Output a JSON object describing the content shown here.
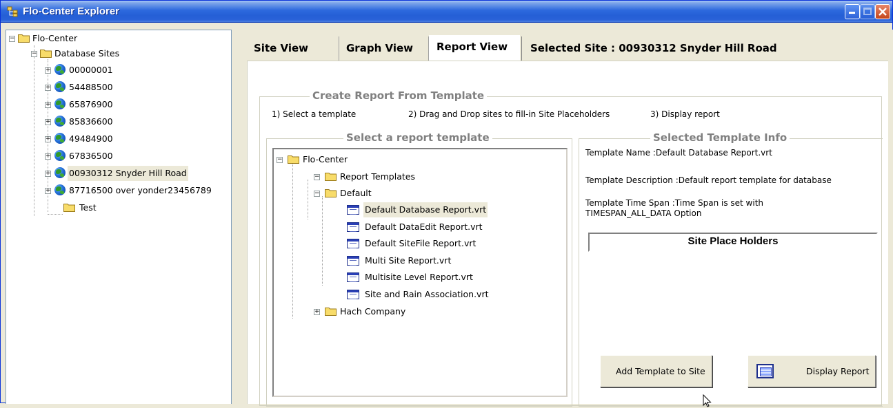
{
  "window": {
    "title": "Flo-Center Explorer",
    "icon": "tree-app-icon",
    "controls": [
      "minimize-icon",
      "maximize-icon",
      "close-icon"
    ]
  },
  "left_tree": {
    "root": "Flo-Center",
    "database_sites": "Database Sites",
    "sites": [
      "00000001",
      "54488500",
      "65876900",
      "85836600",
      "49484900",
      "67836500",
      "00930312 Snyder Hill Road",
      "87716500 over yonder23456789"
    ],
    "selected_site_index": 6,
    "test_folder": "Test"
  },
  "tabs": [
    {
      "label": "Site View",
      "active": false
    },
    {
      "label": "Graph View",
      "active": false
    },
    {
      "label": "Report View",
      "active": true
    }
  ],
  "selected_site_label": "Selected Site : 00930312 Snyder Hill Road",
  "report": {
    "group_title": "Create Report From Template",
    "steps": [
      "1) Select a template",
      "2) Drag and Drop sites to fill-in Site Placeholders",
      "3) Display report"
    ],
    "select_template_title": "Select a report template",
    "template_tree": {
      "root": "Flo-Center",
      "report_templates": "Report Templates",
      "default_folder": "Default",
      "templates": [
        "Default Database Report.vrt",
        "Default DataEdit Report.vrt",
        "Default SiteFile Report.vrt",
        "Multi Site Report.vrt",
        "Multisite Level Report.vrt",
        "Site and Rain Association.vrt"
      ],
      "selected_template_index": 0,
      "hach_folder": "Hach Company"
    },
    "info_title": "Selected Template Info",
    "template_name": "Template Name :Default Database Report.vrt",
    "template_description": "Template Description :Default report template for database",
    "template_time_span_line1": "Template Time Span :Time Span is set with",
    "template_time_span_line2": "TIMESPAN_ALL_DATA Option",
    "site_place_holders": "Site Place Holders",
    "add_template_button": "Add Template to Site",
    "display_report_button": "Display Report"
  }
}
